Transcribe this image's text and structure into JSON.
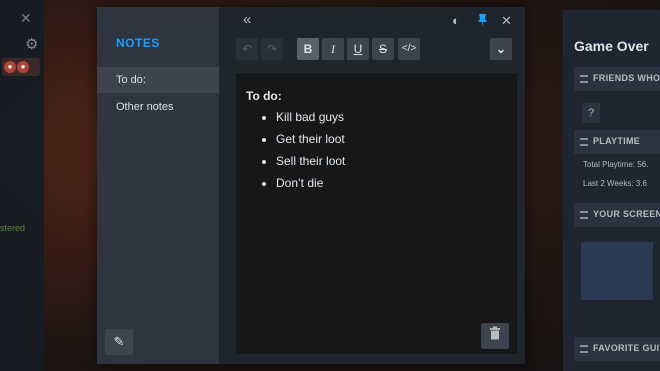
{
  "app": {
    "title": "NOTES"
  },
  "notes_list": [
    {
      "label": "To do:",
      "active": true
    },
    {
      "label": "Other notes",
      "active": false
    }
  ],
  "topbar": {
    "collapse_icon": "«",
    "contrast_icon": "◐",
    "pin_icon": "📌",
    "close_icon": "✕"
  },
  "toolbar": {
    "undo": "↶",
    "redo": "↷",
    "bold": "B",
    "italic": "I",
    "underline": "U",
    "strikethrough": "S",
    "code": "</>",
    "more": "⌄"
  },
  "note": {
    "title": "To do:",
    "items": [
      "Kill bad guys",
      "Get their loot",
      "Sell their loot",
      "Don’t die"
    ]
  },
  "right_panel": {
    "title": "Game Over",
    "friends_label": "FRIENDS WHO",
    "friends_placeholder": "?",
    "playtime_label": "PLAYTIME",
    "total_playtime": "Total Playtime: 56.",
    "last_two_weeks": "Last 2 Weeks: 3.6",
    "screenshots_label": "YOUR SCREEN",
    "favorite_label": "FAVORITE GUI"
  },
  "left_strip": {
    "status": "stered"
  },
  "colors": {
    "accent": "#1a9fff",
    "panel": "#23292f",
    "editor": "#151719"
  }
}
